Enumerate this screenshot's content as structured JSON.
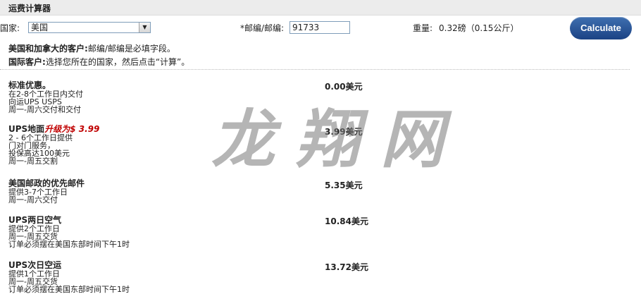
{
  "header": {
    "title": "运费计算器"
  },
  "form": {
    "country_label": "国家:",
    "country_value": "美国",
    "zip_label": "*邮编/邮编:",
    "zip_value": "91733",
    "weight_label": "重量:",
    "weight_value": "0.32磅（0.15公斤）",
    "calculate_label": "Calculate"
  },
  "notes": [
    {
      "bold": "美国和加拿大的客户:",
      "text": "邮编/邮编是必填字段。"
    },
    {
      "bold": "国际客户:",
      "text": "选择您所在的国家，然后点击“计算”。"
    }
  ],
  "options": [
    {
      "name": "标准优惠。",
      "upgrade": "",
      "lines": [
        "在2-8个工作日内交付",
        "向运UPS USPS",
        "周一-周六交付和交付"
      ],
      "price": "0.00美元"
    },
    {
      "name": "UPS地面",
      "upgrade": "升级为$ 3.99",
      "lines": [
        "2 - 6个工作日提供",
        "门对门服务，",
        "投保高达100美元",
        "周一-周五交割"
      ],
      "price": "3.99美元"
    },
    {
      "name": "美国邮政的优先邮件",
      "upgrade": "",
      "lines": [
        "提供3-7个工作日",
        "周一-周六交付"
      ],
      "price": "5.35美元"
    },
    {
      "name": "UPS两日空气",
      "upgrade": "",
      "lines": [
        "提供2个工作日",
        "周一-周五交货",
        "订单必须摆在美国东部时间下午1时"
      ],
      "price": "10.84美元"
    },
    {
      "name": "UPS次日空运",
      "upgrade": "",
      "lines": [
        "提供1个工作日",
        "周一-周五交货",
        "订单必须摆在美国东部时间下午1时"
      ],
      "price": "13.72美元"
    }
  ],
  "watermark": "龙翔网",
  "colors": {
    "button": "#1b4284",
    "upgrade": "#c00000"
  },
  "icons": {
    "select_arrow": "chevron-down-icon"
  }
}
